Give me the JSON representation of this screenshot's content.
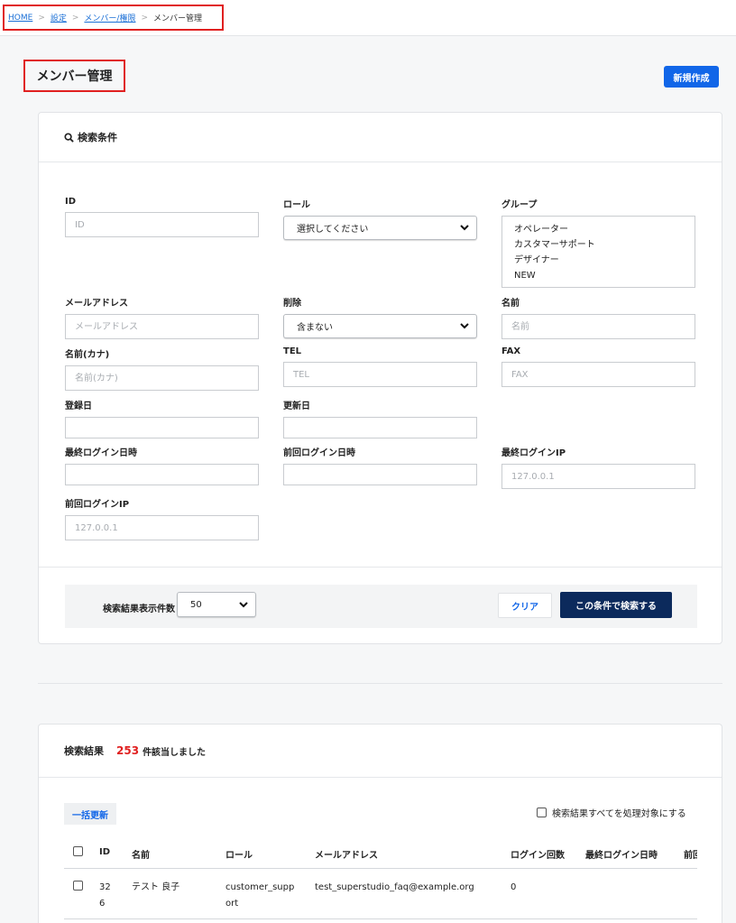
{
  "breadcrumb": {
    "home": "HOME",
    "settings": "設定",
    "members_permissions": "メンバー/権限",
    "current": "メンバー管理",
    "separator": ">"
  },
  "page": {
    "title": "メンバー管理",
    "new_button": "新規作成"
  },
  "search": {
    "heading": "検索条件",
    "fields": {
      "id": {
        "label": "ID",
        "placeholder": "ID"
      },
      "role": {
        "label": "ロール",
        "selected": "選択してください"
      },
      "group": {
        "label": "グループ",
        "options": [
          "オペレーター",
          "カスタマーサポート",
          "デザイナー",
          "NEW"
        ]
      },
      "email": {
        "label": "メールアドレス",
        "placeholder": "メールアドレス"
      },
      "deleted": {
        "label": "削除",
        "selected": "含まない"
      },
      "name": {
        "label": "名前",
        "placeholder": "名前"
      },
      "name_kana": {
        "label": "名前(カナ)",
        "placeholder": "名前(カナ)"
      },
      "tel": {
        "label": "TEL",
        "placeholder": "TEL"
      },
      "fax": {
        "label": "FAX",
        "placeholder": "FAX"
      },
      "registered": {
        "label": "登録日"
      },
      "updated": {
        "label": "更新日"
      },
      "last_login": {
        "label": "最終ログイン日時"
      },
      "prev_login": {
        "label": "前回ログイン日時"
      },
      "last_login_ip": {
        "label": "最終ログインIP",
        "placeholder": "127.0.0.1"
      },
      "prev_login_ip": {
        "label": "前回ログインIP",
        "placeholder": "127.0.0.1"
      }
    },
    "per_page_label": "検索結果表示件数",
    "per_page_value": "50",
    "clear_button": "クリア",
    "search_button": "この条件で検索する"
  },
  "results": {
    "title": "検索結果",
    "count": "253",
    "count_suffix": "件該当しました",
    "bulk_update": "一括更新",
    "select_all_label": "検索結果すべてを処理対象にする",
    "columns": [
      "ID",
      "名前",
      "ロール",
      "メールアドレス",
      "ログイン回数",
      "最終ログイン日時",
      "前回ログイン日時"
    ],
    "rows": [
      {
        "id": "326",
        "name": "テスト 良子",
        "role": "customer_support",
        "email": "test_superstudio_faq@example.org",
        "login_count": "0"
      }
    ]
  }
}
